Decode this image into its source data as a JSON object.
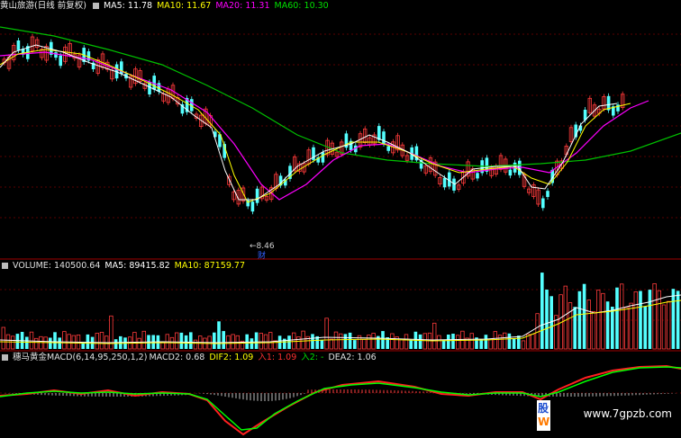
{
  "price_legend": {
    "stock": "黄山旅游(日线 前复权)",
    "ma5": "MA5: 11.78",
    "ma10": "MA10: 11.67",
    "ma20": "MA20: 11.31",
    "ma60": "MA60: 10.30"
  },
  "price_low_label": "8.46",
  "finance_marker": "财",
  "volume_legend": {
    "volume": "VOLUME: 140500.64",
    "ma5": "MA5: 89415.82",
    "ma10": "MA10: 87159.77"
  },
  "indicator_legend": {
    "name": "穗马黄金MACD(6,14,95,250,1,2)",
    "macd2": "MACD2: 0.68",
    "dif2": "DIF2: 1.09",
    "in1": "入1: 1.09",
    "in2": "入2: -",
    "dea2": "DEA2: 1.06"
  },
  "watermark": "www.7gpzb.com",
  "colors": {
    "up": "#ff3b3b",
    "down": "#54ffff",
    "ma5": "#ffffff",
    "ma10": "#ffff00",
    "ma20": "#ff00ff",
    "ma60": "#00c000",
    "grid_red": "#800000"
  }
}
